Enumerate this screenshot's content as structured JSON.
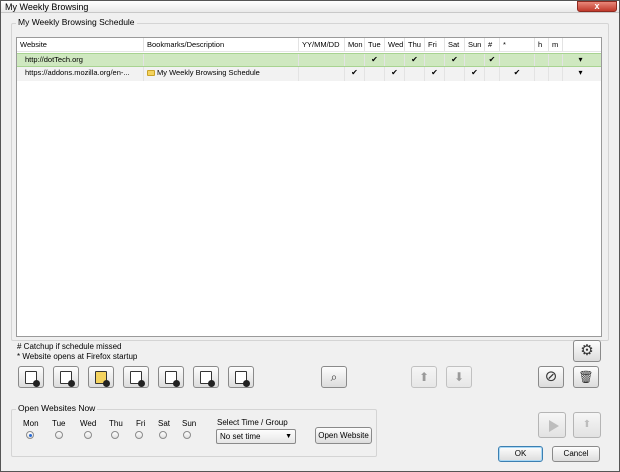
{
  "window": {
    "title": "My Weekly Browsing",
    "close_label": "x"
  },
  "schedule": {
    "group_label": "My Weekly Browsing Schedule",
    "columns": [
      "Website",
      "Bookmarks/Description",
      "YY/MM/DD",
      "Mon",
      "Tue",
      "Wed",
      "Thu",
      "Fri",
      "Sat",
      "Sun",
      "#",
      "*",
      "h",
      "m",
      ""
    ],
    "rows": [
      {
        "website": "http://dotTech.org",
        "bookmark": "",
        "date": "",
        "mon": "",
        "tue": "✔",
        "wed": "",
        "thu": "✔",
        "fri": "",
        "sat": "✔",
        "sun": "",
        "hash": "✔",
        "star": "",
        "h": "",
        "m": "",
        "last": "▾",
        "bookmark_icon": false
      },
      {
        "website": "https://addons.mozilla.org/en-...",
        "bookmark": "My Weekly Browsing Schedule",
        "date": "",
        "mon": "✔",
        "tue": "",
        "wed": "✔",
        "thu": "",
        "fri": "✔",
        "sat": "",
        "sun": "✔",
        "hash": "",
        "star": "✔",
        "h": "",
        "m": "",
        "last": "▾",
        "bookmark_icon": true
      }
    ]
  },
  "notes": {
    "catchup": "#  Catchup if schedule missed",
    "startup": "*  Website opens at Firefox startup"
  },
  "toolbar": {
    "icons": [
      "new-site-icon",
      "new-bookmark-icon",
      "new-folder-icon",
      "new-page-icon",
      "new-doc-icon",
      "new-list-icon",
      "new-web-icon",
      "find-icon",
      "move-up-icon",
      "move-down-icon",
      "disable-icon",
      "trash-icon",
      "gear-icon"
    ]
  },
  "open_now": {
    "group_label": "Open Websites Now",
    "days": [
      "Mon",
      "Tue",
      "Wed",
      "Thu",
      "Fri",
      "Sat",
      "Sun"
    ],
    "selected_day": "Mon",
    "time_label": "Select Time / Group",
    "time_value": "No set time",
    "open_button": "Open Website"
  },
  "dialog": {
    "ok": "OK",
    "cancel": "Cancel"
  }
}
